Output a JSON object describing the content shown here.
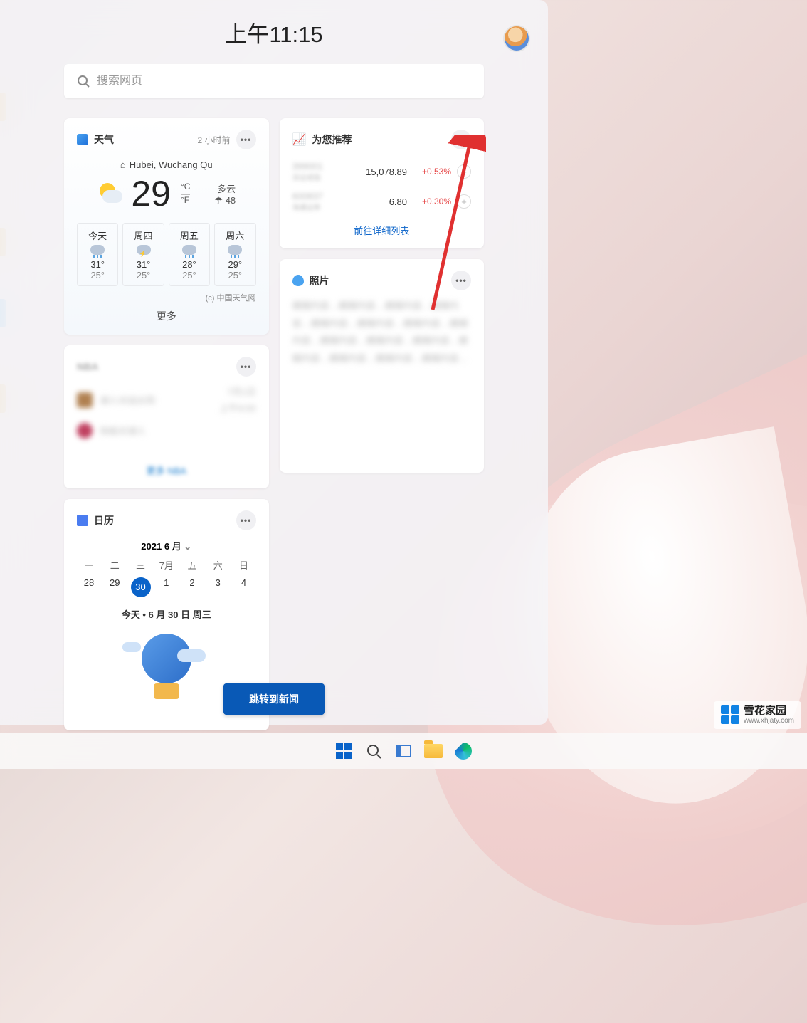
{
  "header": {
    "clock": "上午11:15"
  },
  "search": {
    "placeholder": "搜索网页"
  },
  "weather": {
    "title": "天气",
    "timestamp": "2 小时前",
    "location": "Hubei, Wuchang Qu",
    "temp": "29",
    "unit_c": "°C",
    "unit_f": "°F",
    "condition": "多云",
    "humidity": "☂ 48",
    "forecast": [
      {
        "name": "今天",
        "icon": "rain",
        "hi": "31°",
        "lo": "25°"
      },
      {
        "name": "周四",
        "icon": "thunder",
        "hi": "31°",
        "lo": "25°"
      },
      {
        "name": "周五",
        "icon": "rain",
        "hi": "28°",
        "lo": "25°"
      },
      {
        "name": "周六",
        "icon": "rain",
        "hi": "29°",
        "lo": "25°"
      }
    ],
    "attrib": "(c) 中国天气网",
    "more": "更多"
  },
  "sports": {
    "title": "NBA",
    "row1": "湖人对战太阳",
    "row2": "快船对湖人",
    "date": "7月1日",
    "time": "上午9:00",
    "foot": "更多 NBA"
  },
  "calendar": {
    "title": "日历",
    "month": "2021 6 月",
    "headers": [
      "一",
      "二",
      "三",
      "7月",
      "五",
      "六",
      "日"
    ],
    "days": [
      "28",
      "29",
      "30",
      "1",
      "2",
      "3",
      "4"
    ],
    "today_index": 2,
    "today_text": "今天 • 6 月 30 日 周三"
  },
  "stocks": {
    "title": "为您推荐",
    "rows": [
      {
        "name": "399001",
        "sub": "深证成指",
        "value": "15,078.89",
        "pct": "+0.53%"
      },
      {
        "name": "600837",
        "sub": "海通证券",
        "value": "6.80",
        "pct": "+0.30%"
      }
    ],
    "link": "前往详细列表"
  },
  "photos": {
    "title": "照片",
    "body": "模糊内容…模糊内容…模糊内容…模糊内容…模糊内容…模糊内容…模糊内容…模糊内容…模糊内容…模糊内容…模糊内容…模糊内容…模糊内容…模糊内容…模糊内容…"
  },
  "news_button": "跳转到新闻",
  "watermark": {
    "text": "雪花家园",
    "url": "www.xhjaty.com"
  }
}
